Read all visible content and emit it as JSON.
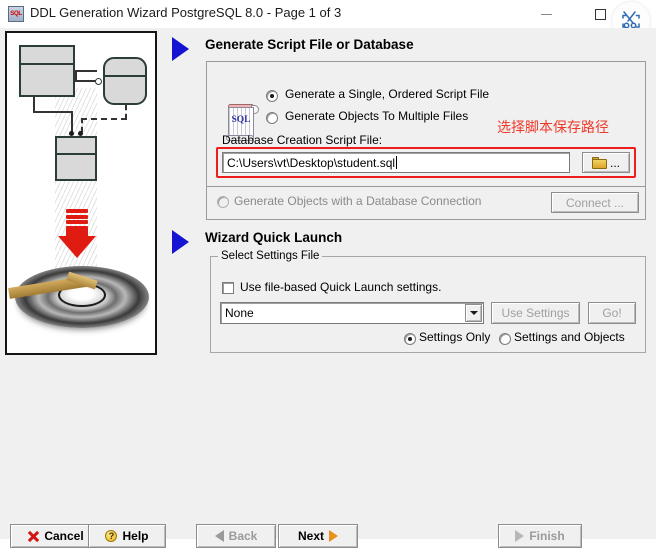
{
  "window": {
    "title": "DDL Generation Wizard PostgreSQL 8.0 - Page 1 of 3",
    "app_icon": "SQL",
    "minimize_label": "Minimize",
    "maximize_label": "Maximize",
    "snip_tool": "screenshot-capture-icon"
  },
  "illustration": {
    "alt": "ER entities flowing down onto a disk platter"
  },
  "section1": {
    "heading": "Generate Script File or Database",
    "icon": "sql-scroll-icon",
    "radio_single": "Generate a Single, Ordered Script File",
    "radio_multiple": "Generate Objects To Multiple Files",
    "field_label": "Database Creation Script File:",
    "script_path": "C:\\Users\\vt\\Desktop\\student.sql",
    "browse_label": "...",
    "browse_icon": "folder-icon",
    "radio_connection": "Generate Objects with a Database Connection",
    "connect_button": "Connect ...",
    "selected_radio": "single"
  },
  "section2": {
    "heading": "Wizard Quick Launch",
    "group_label": "Select Settings File",
    "checkbox_label": "Use file-based Quick Launch settings.",
    "checkbox_checked": false,
    "combo_value": "None",
    "use_settings_button": "Use Settings",
    "go_button": "Go!",
    "radio_settings_only": "Settings Only",
    "radio_settings_objects": "Settings and Objects",
    "selected_radio": "settings_only"
  },
  "annotation": {
    "text": "选择脚本保存路径",
    "color": "#ee3a2a",
    "box_color": "#ee1c1c"
  },
  "footer": {
    "cancel": "Cancel",
    "help": "Help",
    "back": "Back",
    "next": "Next",
    "finish": "Finish"
  }
}
